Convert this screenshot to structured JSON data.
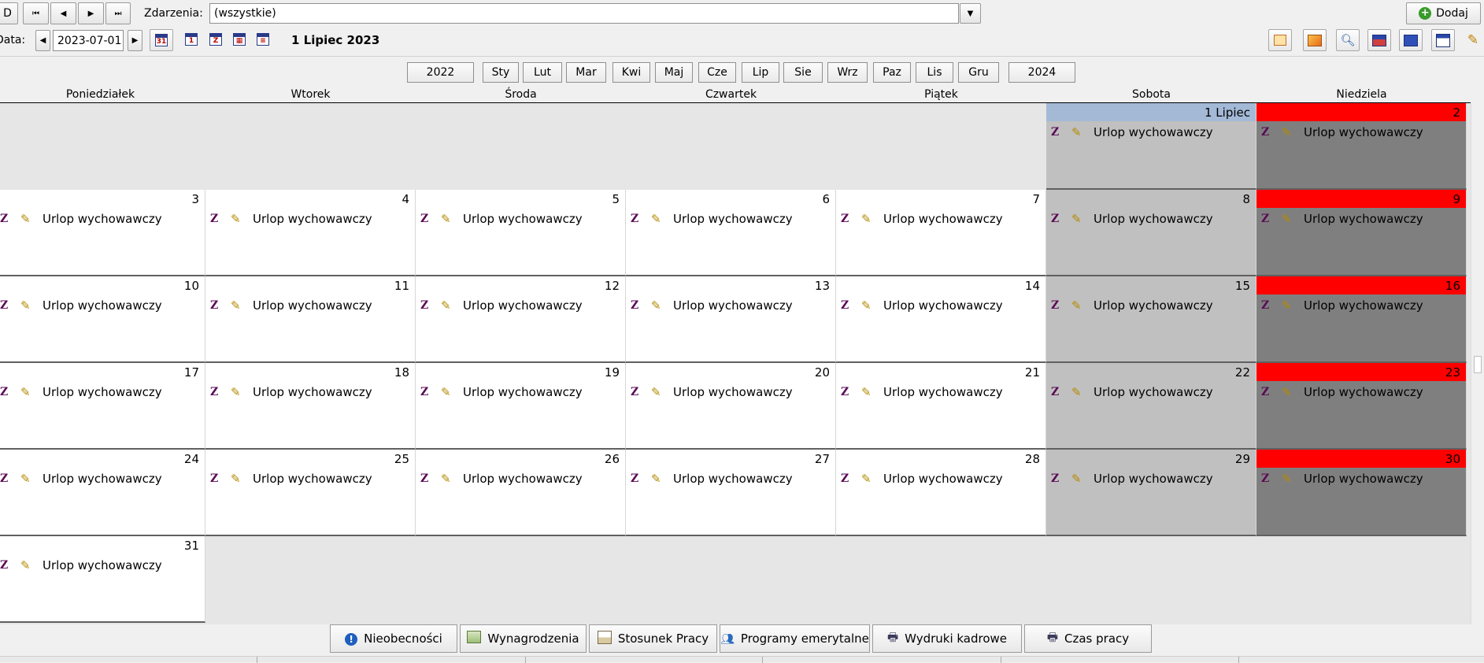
{
  "toolbar": {
    "first_btn_partial": "D",
    "nav_first": "⏮",
    "nav_prev": "◀",
    "nav_next": "▶",
    "nav_last": "⏭",
    "events_label": "Zdarzenia:",
    "events_value": "(wszystkie)",
    "add_label": "Dodaj",
    "date_label": "Data:",
    "date_value": "2023-07-01",
    "current_date_title": "1 Lipiec 2023"
  },
  "year_prev": "2022",
  "year_next": "2024",
  "months": [
    "Sty",
    "Lut",
    "Mar",
    "Kwi",
    "Maj",
    "Cze",
    "Lip",
    "Sie",
    "Wrz",
    "Paz",
    "Lis",
    "Gru"
  ],
  "weekdays": [
    "Poniedziałek",
    "Wtorek",
    "Środa",
    "Czwartek",
    "Piątek",
    "Sobota",
    "Niedziela"
  ],
  "first_day_label": "1 Lipiec",
  "event_label": "Urlop wychowawczy",
  "event_code": "Z",
  "month_start_col": 5,
  "days_in_month": 31,
  "colors": {
    "outside": "#e6e6e6",
    "weekday": "#ffffff",
    "saturday": "#c0c0c0",
    "sunday": "#7f7f7f",
    "sunday_header": "#ff0000",
    "selected_header": "#a3b9d6"
  },
  "bottom_tabs": [
    {
      "label": "Nieobecności",
      "icon": "info-icon"
    },
    {
      "label": "Wynagrodzenia",
      "icon": "money-icon"
    },
    {
      "label": "Stosunek Pracy",
      "icon": "document-icon"
    },
    {
      "label": "Programy emerytalne",
      "icon": "people-icon"
    },
    {
      "label": "Wydruki kadrowe",
      "icon": "printer-icon"
    },
    {
      "label": "Czas pracy",
      "icon": "printer-icon"
    }
  ]
}
